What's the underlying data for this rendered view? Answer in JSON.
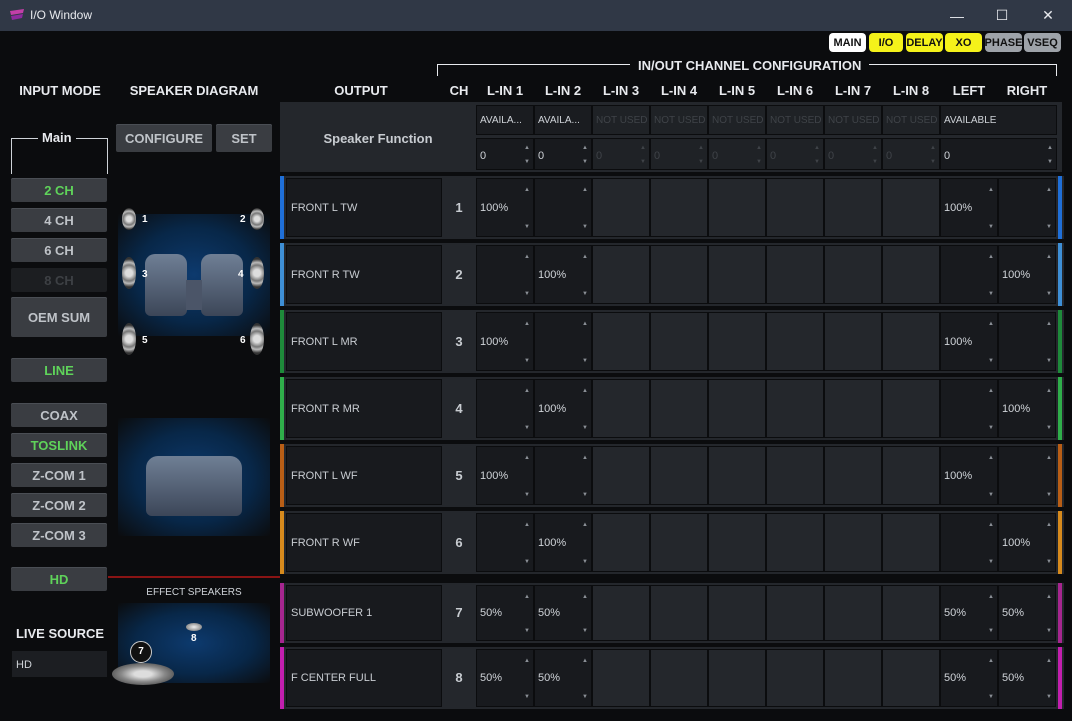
{
  "window": {
    "title": "I/O Window",
    "minimize": "—",
    "maximize": "☐",
    "close": "✕"
  },
  "nav_badges": [
    {
      "label": "MAIN",
      "bg": "#ffffff"
    },
    {
      "label": "I/O",
      "bg": "#f5f21a"
    },
    {
      "label": "DELAY",
      "bg": "#f5f21a"
    },
    {
      "label": "XO",
      "bg": "#f5f21a"
    },
    {
      "label": "PHASE",
      "bg": "#9ea3a9"
    },
    {
      "label": "VSEQ",
      "bg": "#9ea3a9"
    }
  ],
  "section_title": "IN/OUT CHANNEL CONFIGURATION",
  "headers": {
    "input_mode": "INPUT MODE",
    "speaker_diagram": "SPEAKER DIAGRAM",
    "output": "OUTPUT",
    "ch": "CH"
  },
  "input_cols": [
    "L-IN 1",
    "L-IN 2",
    "L-IN 3",
    "L-IN 4",
    "L-IN 5",
    "L-IN 6",
    "L-IN 7",
    "L-IN 8",
    "LEFT",
    "RIGHT"
  ],
  "input_mode": {
    "group_label": "Main",
    "buttons": [
      "2 CH",
      "4 CH",
      "6 CH",
      "8 CH",
      "OEM SUM"
    ],
    "line": "LINE",
    "digital": [
      "COAX",
      "TOSLINK",
      "Z-COM 1",
      "Z-COM 2",
      "Z-COM 3"
    ],
    "hd": "HD",
    "live_source_label": "LIVE SOURCE",
    "live_source_value": "HD"
  },
  "speaker_diagram": {
    "configure": "CONFIGURE",
    "set": "SET",
    "effect_speakers": "EFFECT SPEAKERS",
    "speaker_numbers": [
      "1",
      "2",
      "3",
      "4",
      "5",
      "6",
      "7",
      "8"
    ]
  },
  "speaker_function_label": "Speaker Function",
  "availability": [
    "AVAILA...",
    "AVAILA...",
    "NOT USED",
    "NOT USED",
    "NOT USED",
    "NOT USED",
    "NOT USED",
    "NOT USED",
    "AVAILABLE"
  ],
  "availability_values": [
    "0",
    "0",
    "0",
    "0",
    "0",
    "0",
    "0",
    "0",
    "0"
  ],
  "channels": [
    {
      "ch": "1",
      "name": "FRONT L TW",
      "color": "#1f6fd8",
      "values": [
        "100%",
        "",
        "",
        "",
        "",
        "",
        "",
        "",
        "100%",
        ""
      ]
    },
    {
      "ch": "2",
      "name": "FRONT R TW",
      "color": "#3e8fd6",
      "values": [
        "",
        "100%",
        "",
        "",
        "",
        "",
        "",
        "",
        "",
        "100%"
      ]
    },
    {
      "ch": "3",
      "name": "FRONT L MR",
      "color": "#1e8a3a",
      "values": [
        "100%",
        "",
        "",
        "",
        "",
        "",
        "",
        "",
        "100%",
        ""
      ]
    },
    {
      "ch": "4",
      "name": "FRONT R MR",
      "color": "#2fae4a",
      "values": [
        "",
        "100%",
        "",
        "",
        "",
        "",
        "",
        "",
        "",
        "100%"
      ]
    },
    {
      "ch": "5",
      "name": "FRONT L WF",
      "color": "#b85e16",
      "values": [
        "100%",
        "",
        "",
        "",
        "",
        "",
        "",
        "",
        "100%",
        ""
      ]
    },
    {
      "ch": "6",
      "name": "FRONT R WF",
      "color": "#d68a1d",
      "values": [
        "",
        "100%",
        "",
        "",
        "",
        "",
        "",
        "",
        "",
        "100%"
      ]
    },
    {
      "ch": "7",
      "name": "SUBWOOFER 1",
      "color": "#a6268f",
      "values": [
        "50%",
        "50%",
        "",
        "",
        "",
        "",
        "",
        "",
        "50%",
        "50%"
      ]
    },
    {
      "ch": "8",
      "name": "F CENTER FULL",
      "color": "#c21fae",
      "values": [
        "50%",
        "50%",
        "",
        "",
        "",
        "",
        "",
        "",
        "50%",
        "50%"
      ]
    }
  ]
}
